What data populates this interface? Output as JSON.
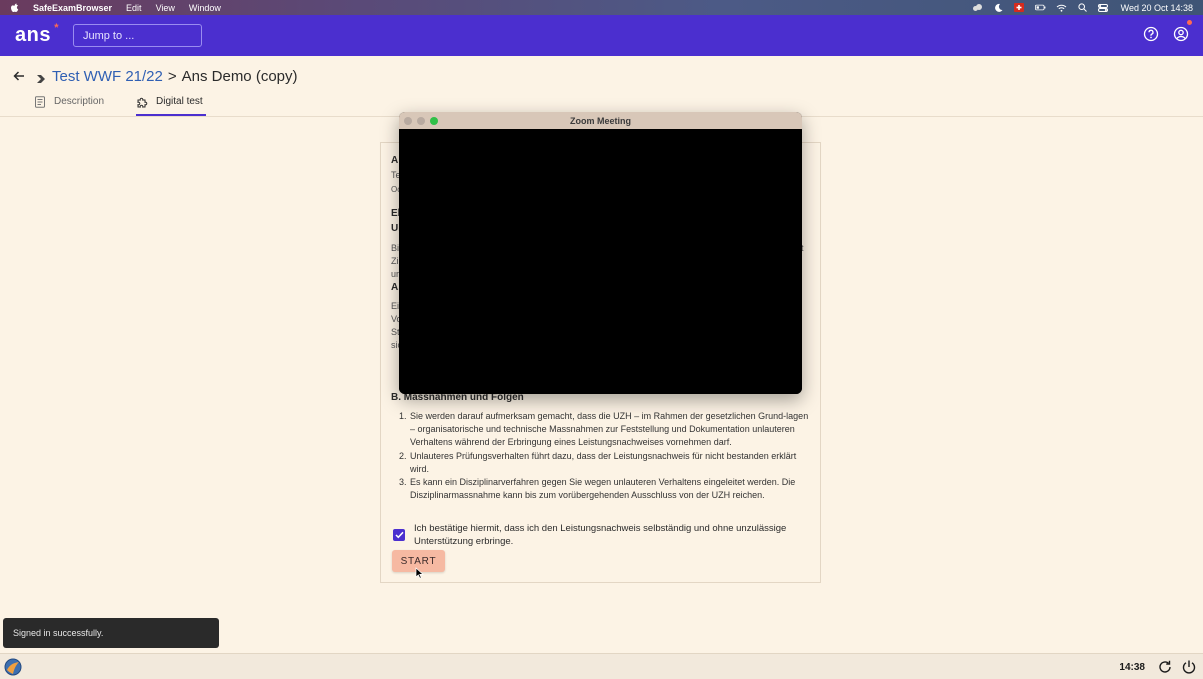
{
  "menubar": {
    "app_name": "SafeExamBrowser",
    "menus": [
      "Edit",
      "View",
      "Window"
    ],
    "clock": "Wed 20 Oct  14:38"
  },
  "header": {
    "logo": "ans",
    "logo_mark": "*",
    "search_placeholder": "Jump to ..."
  },
  "breadcrumb": {
    "parent": "Test WWF 21/22",
    "separator": ">",
    "current": "Ans Demo (copy)"
  },
  "tabs": [
    {
      "label": "Description",
      "icon": "document-icon",
      "active": false
    },
    {
      "label": "Digital test",
      "icon": "puzzle-icon",
      "active": true
    }
  ],
  "card": {
    "peek_lines": [
      "A",
      "Te",
      "Oc",
      "Eh",
      "Ui",
      "Bi",
      "Zi",
      "ur",
      "A.",
      "Ei",
      "Vo",
      "St",
      "sic"
    ],
    "peek_right": "t",
    "section_title": "B. Massnahmen und Folgen",
    "items": [
      "Sie werden darauf aufmerksam gemacht, dass die UZH – im Rahmen der gesetzlichen Grund-lagen – organisatorische und technische Massnahmen zur Feststellung und Dokumentation unlauteren Verhaltens während der Erbringung eines Leistungsnachweises vornehmen darf.",
      "Unlauteres Prüfungsverhalten führt dazu, dass der Leistungsnachweis für nicht bestanden erklärt wird.",
      "Es kann ein Disziplinarverfahren gegen Sie wegen unlauteren Verhaltens eingeleitet werden. Die Disziplinarmassnahme kann bis zum vorübergehenden Ausschluss von der UZH reichen."
    ],
    "item_numbers": [
      "1.",
      "2.",
      "3."
    ],
    "confirm_text": "Ich bestätige hiermit, dass ich den Leistungsnachweis selbständig und ohne unzulässige Unterstützung erbringe.",
    "confirm_checked": true,
    "start_label": "START"
  },
  "zoom": {
    "title": "Zoom Meeting"
  },
  "toast": {
    "message": "Signed in successfully."
  },
  "taskbar": {
    "time": "14:38"
  },
  "colors": {
    "brand": "#4b2fcf",
    "accent": "#ff6b52",
    "start_button": "#f6b9a2",
    "page_bg": "#fcf3e5"
  }
}
